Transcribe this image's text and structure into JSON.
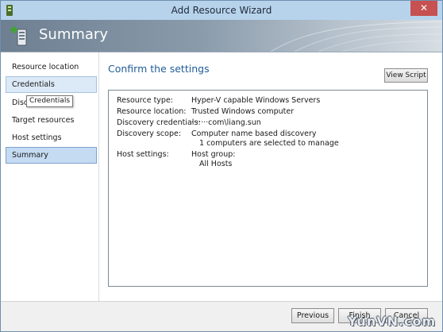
{
  "window": {
    "title": "Add Resource Wizard",
    "close_glyph": "✕"
  },
  "header": {
    "title": "Summary",
    "icon": "server-add-icon"
  },
  "nav": {
    "items": [
      {
        "label": "Resource location"
      },
      {
        "label": "Credentials"
      },
      {
        "label": "Disco"
      },
      {
        "label": "Target resources"
      },
      {
        "label": "Host settings"
      },
      {
        "label": "Summary"
      }
    ],
    "tooltip": "Credentials"
  },
  "content": {
    "title": "Confirm the settings",
    "view_script_label": "View Script",
    "summary": {
      "resource_type_label": "Resource type:",
      "resource_type_value": "Hyper-V capable Windows Servers",
      "resource_location_label": "Resource location:",
      "resource_location_value": "Trusted Windows computer",
      "discovery_credentials_label": "Discovery credentials:",
      "discovery_credentials_value": "·······com\\liang.sun",
      "discovery_scope_label": "Discovery scope:",
      "discovery_scope_value": "Computer name based discovery",
      "discovery_scope_detail": "1 computers are selected to manage",
      "host_settings_label": "Host settings:",
      "host_settings_value": "Host group:",
      "host_settings_detail": "All Hosts"
    }
  },
  "footer": {
    "previous_label": "Previous",
    "finish_label": "Finish",
    "cancel_label": "Cancel"
  },
  "watermark": "YunVN.com",
  "colors": {
    "accent": "#1f5c99",
    "titlebar": "#b7d3ec",
    "close": "#c75050",
    "nav_selected": "#c5dbf2"
  }
}
